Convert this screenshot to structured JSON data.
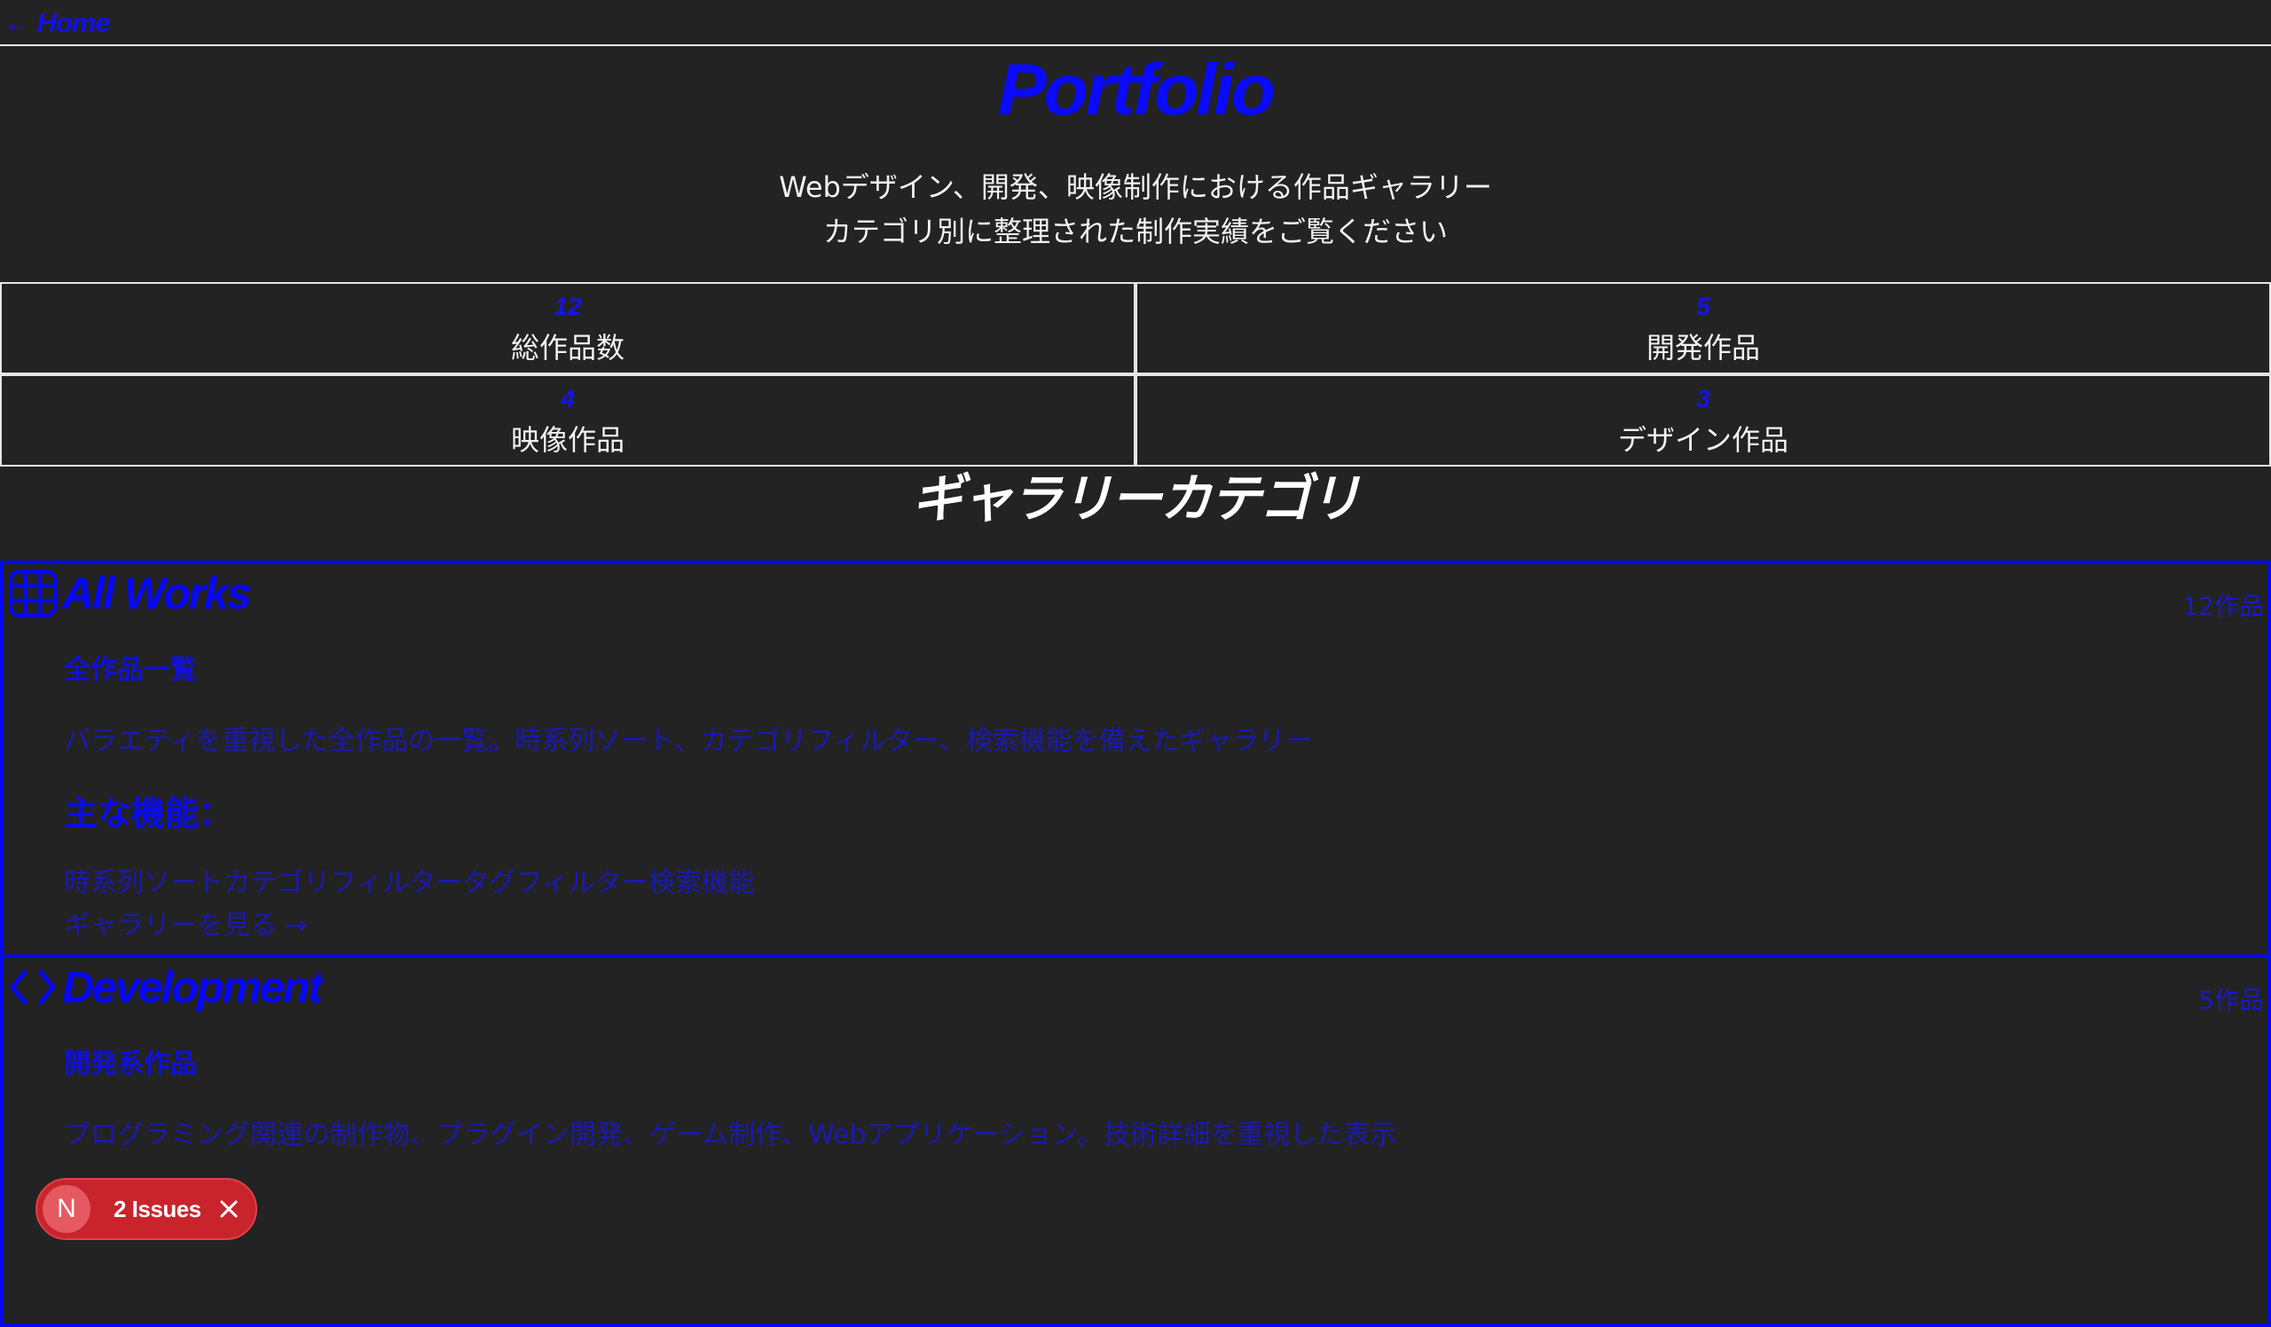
{
  "nav": {
    "home_link": "← Home"
  },
  "header": {
    "title": "Portfolio",
    "subtitle_line1": "Webデザイン、開発、映像制作における作品ギャラリー",
    "subtitle_line2": "カテゴリ別に整理された制作実績をご覧ください"
  },
  "stats": [
    {
      "value": "12",
      "label": "総作品数"
    },
    {
      "value": "5",
      "label": "開発作品"
    },
    {
      "value": "4",
      "label": "映像作品"
    },
    {
      "value": "3",
      "label": "デザイン作品"
    }
  ],
  "gallery_section": {
    "title": "ギャラリーカテゴリ"
  },
  "categories": [
    {
      "icon": "grid-icon",
      "title": "All Works",
      "count": "12作品",
      "subtitle": "全作品一覧",
      "description": "バラエティを重視した全作品の一覧。時系列ソート、カテゴリフィルター、検索機能を備えたギャラリー",
      "features_heading": "主な機能：",
      "features": "時系列ソートカテゴリフィルタータグフィルター検索機能",
      "link": "ギャラリーを見る →"
    },
    {
      "icon": "code-icon",
      "title": "Development",
      "count": "5作品",
      "subtitle": "開発系作品",
      "description": "プログラミング関連の制作物、プラグイン開発、ゲーム制作、Webアプリケーション。技術詳細を重視した表示"
    }
  ],
  "issues_badge": {
    "avatar_letter": "N",
    "label": "2 Issues"
  },
  "colors": {
    "background": "#232323",
    "accent": "#0808ff",
    "badge": "#c9242c"
  }
}
